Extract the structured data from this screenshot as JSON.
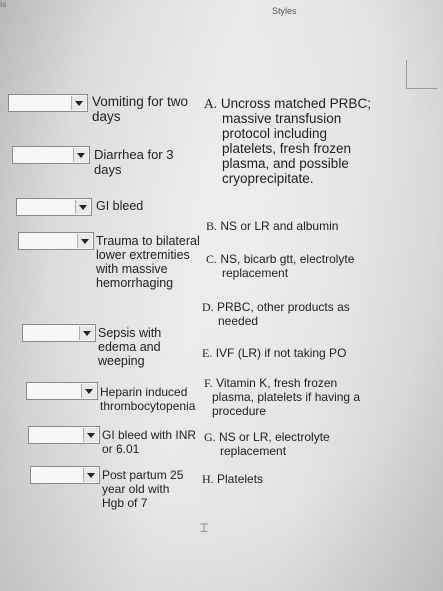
{
  "window": {
    "corner_label": "Is",
    "styles_label": "Styles"
  },
  "dropdowns": [
    {
      "value": ""
    },
    {
      "value": ""
    },
    {
      "value": ""
    },
    {
      "value": ""
    },
    {
      "value": ""
    },
    {
      "value": ""
    },
    {
      "value": ""
    },
    {
      "value": ""
    }
  ],
  "items": [
    "Vomiting for two days",
    "Diarrhea for 3 days",
    "GI bleed",
    "Trauma to bilateral lower extremities with massive hemorrhaging",
    "Sepsis with edema and weeping",
    "Heparin induced thrombocytopenia",
    "GI bleed with INR or 6.01",
    "Post partum 25 year old with Hgb of 7"
  ],
  "options": [
    {
      "letter": "A.",
      "line1": "Uncross matched PRBC;",
      "rest": "massive transfusion protocol including platelets, fresh frozen plasma, and possible cryoprecipitate."
    },
    {
      "letter": "B.",
      "line1": "NS or LR and albumin",
      "rest": ""
    },
    {
      "letter": "C.",
      "line1": "NS, bicarb gtt, electrolyte",
      "rest": "replacement"
    },
    {
      "letter": "D.",
      "line1": "PRBC, other products as",
      "rest": "needed"
    },
    {
      "letter": "E.",
      "line1": "IVF (LR) if not taking PO",
      "rest": ""
    },
    {
      "letter": "F.",
      "line1": "Vitamin K, fresh frozen",
      "rest": "plasma, platelets if having a procedure"
    },
    {
      "letter": "G.",
      "line1": "NS or LR, electrolyte",
      "rest": "replacement"
    },
    {
      "letter": "H.",
      "line1": "Platelets",
      "rest": ""
    }
  ]
}
